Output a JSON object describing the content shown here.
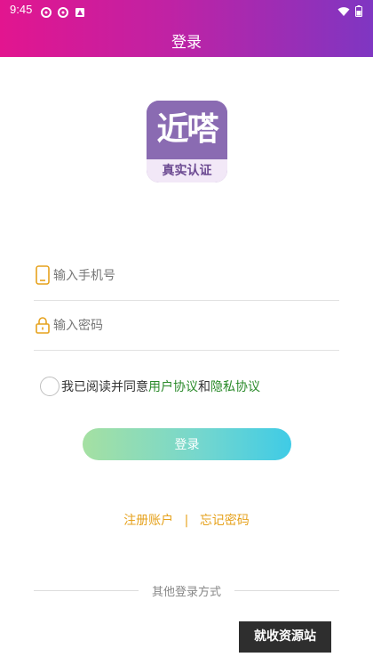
{
  "status_bar": {
    "time": "9:45"
  },
  "header": {
    "title": "登录"
  },
  "logo": {
    "main_text": "近嗒",
    "badge_text": "真实认证"
  },
  "form": {
    "phone_placeholder": "输入手机号",
    "password_placeholder": "输入密码"
  },
  "agreement": {
    "prefix": "我已阅读并同意",
    "user_agreement": "用户协议",
    "and": "和",
    "privacy_agreement": "隐私协议"
  },
  "login_button": "登录",
  "links": {
    "register": "注册账户",
    "separator": "|",
    "forgot": "忘记密码"
  },
  "other_login": "其他登录方式",
  "watermark": "就收资源站",
  "colors": {
    "header_gradient": [
      "#e2158f",
      "#7f36c2"
    ],
    "link_green": "#2a8a2a",
    "link_orange": "#e6a21d",
    "button_gradient": [
      "#a5e0a2",
      "#3fcbe6"
    ]
  }
}
